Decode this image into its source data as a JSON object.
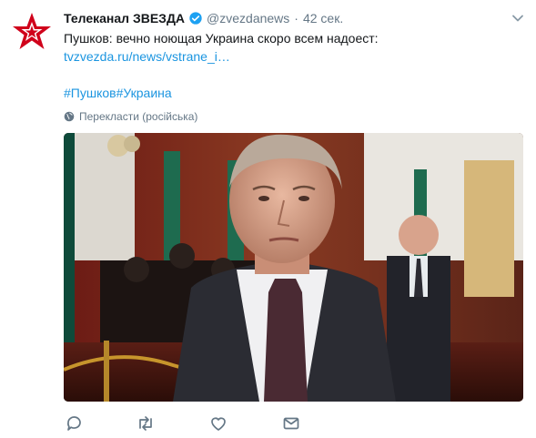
{
  "tweet": {
    "display_name": "Телеканал ЗВЕЗДА",
    "handle": "@zvezdanews",
    "separator": "·",
    "time": "42 сек.",
    "text": "Пушков: вечно ноющая Украина скоро всем надоест:",
    "link": "tvzvezda.ru/news/vstrane_i…",
    "hashtag_1": "#Пушков",
    "hashtag_2": "#Украина",
    "translate_label": "Перекласти (російська)"
  },
  "icons": {
    "avatar": "zvezda-star-logo",
    "verified": "verified-badge-icon",
    "caret": "chevron-down-icon",
    "globe": "globe-icon",
    "reply": "reply-icon",
    "retweet": "retweet-icon",
    "like": "heart-icon",
    "dm": "envelope-icon"
  },
  "colors": {
    "link": "#1b95e0",
    "secondary_text": "#657786",
    "brand_red": "#d0021b"
  }
}
